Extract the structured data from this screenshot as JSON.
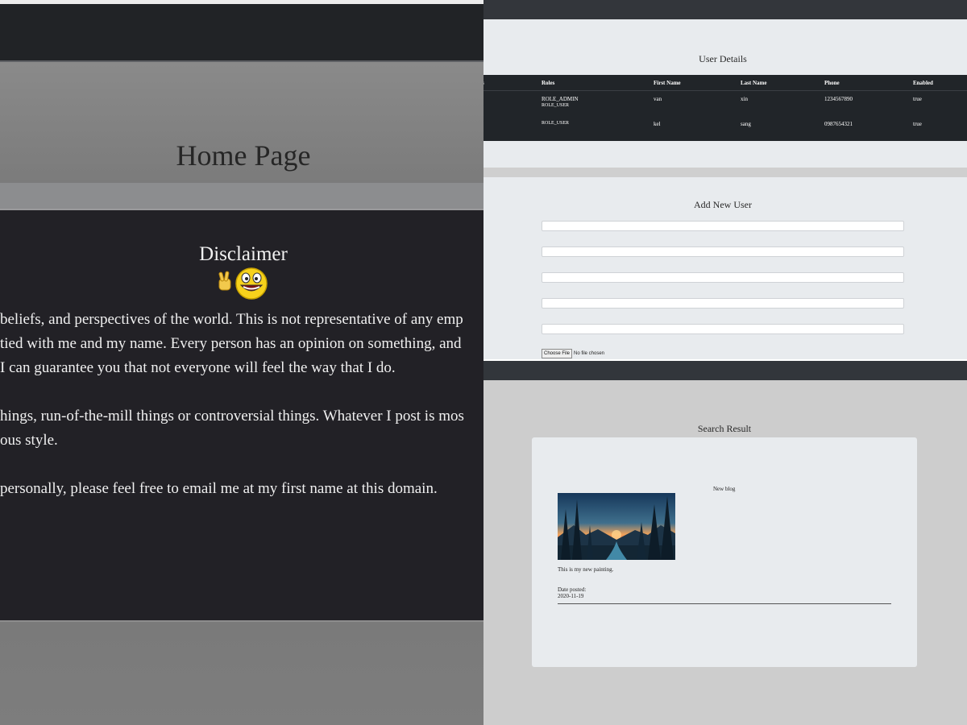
{
  "home": {
    "title": "Home Page",
    "disclaimer_title": "Disclaimer",
    "emoji": "peace-sign-and-grinning-face-icon",
    "paragraph_lines": [
      "beliefs, and perspectives of the world. This is not representative of any emp",
      "tied with me and my name. Every person has an opinion on something, and",
      "I can guarantee you that not everyone will feel the way that I do.",
      "hings, run-of-the-mill things or controversial things. Whatever I post is mos",
      "ous style.",
      "personally, please feel free to email me at my first name at this domain."
    ]
  },
  "user_details": {
    "title": "User Details",
    "columns": [
      "s",
      "Roles",
      "First Name",
      "Last Name",
      "Phone",
      "Enabled"
    ],
    "rows": [
      {
        "roles": [
          "ROLE_ADMIN",
          "ROLE_USER"
        ],
        "first_name": "van",
        "last_name": "xin",
        "phone": "1234567890",
        "enabled": "true"
      },
      {
        "roles": [
          "ROLE_USER"
        ],
        "first_name": "kel",
        "last_name": "sang",
        "phone": "0987654321",
        "enabled": "true"
      }
    ]
  },
  "add_user": {
    "title": "Add New User",
    "field_count": 5,
    "file_button": "Choose File",
    "file_status": "No file chosen"
  },
  "search": {
    "title": "Search Result",
    "blog_title": "New blog",
    "image_alt": "painting-image",
    "description": "This is my new painting.",
    "date_label": "Date posted:",
    "date_value": "2020-11-19"
  },
  "colors": {
    "dark_nav": "#212326",
    "panel_light": "#e8ebee",
    "table_dark": "#212529",
    "disclaimer_bg": "#222126"
  }
}
